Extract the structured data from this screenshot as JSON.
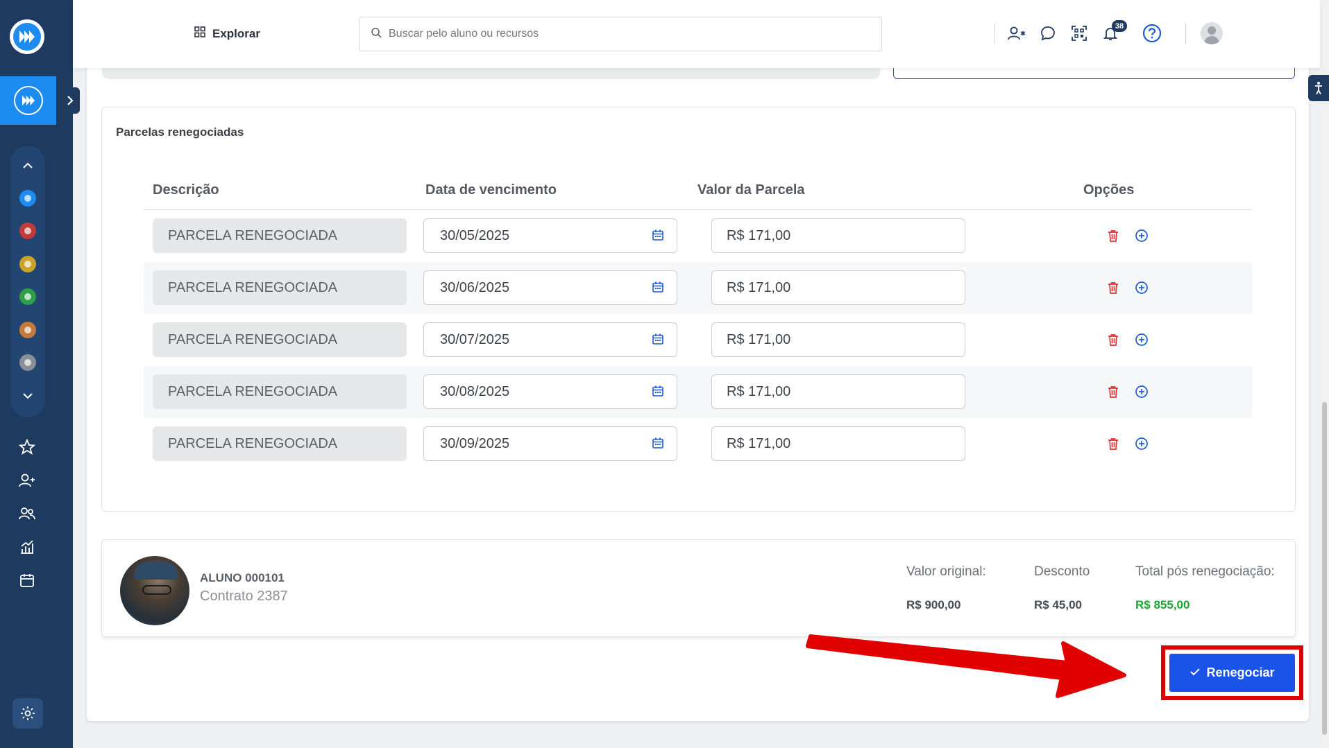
{
  "header": {
    "explore_label": "Explorar",
    "search_placeholder": "Buscar pelo aluno ou recursos",
    "notifications_count": "38"
  },
  "parcelas": {
    "title": "Parcelas renegociadas",
    "columns": {
      "descricao": "Descrição",
      "vencimento": "Data de vencimento",
      "valor": "Valor da Parcela",
      "opcoes": "Opções"
    },
    "rows": [
      {
        "descricao": "PARCELA RENEGOCIADA",
        "vencimento": "30/05/2025",
        "valor": "R$ 171,00"
      },
      {
        "descricao": "PARCELA RENEGOCIADA",
        "vencimento": "30/06/2025",
        "valor": "R$ 171,00"
      },
      {
        "descricao": "PARCELA RENEGOCIADA",
        "vencimento": "30/07/2025",
        "valor": "R$ 171,00"
      },
      {
        "descricao": "PARCELA RENEGOCIADA",
        "vencimento": "30/08/2025",
        "valor": "R$ 171,00"
      },
      {
        "descricao": "PARCELA RENEGOCIADA",
        "vencimento": "30/09/2025",
        "valor": "R$ 171,00"
      }
    ]
  },
  "summary": {
    "student_name": "ALUNO 000101",
    "contract": "Contrato 2387",
    "valor_original_label": "Valor original:",
    "valor_original": "R$ 900,00",
    "desconto_label": "Desconto",
    "desconto": "R$ 45,00",
    "total_label": "Total pós renegociação:",
    "total": "R$ 855,00"
  },
  "actions": {
    "renegociar_label": "Renegociar"
  },
  "colors": {
    "sidebar": "#1e3a5f",
    "accent": "#1c8bf2",
    "primary_button": "#1a53e8",
    "delete_icon": "#e03131",
    "add_icon": "#1c5bd9",
    "total_green": "#1aa52c",
    "annotation_red": "#e00000"
  },
  "icons": {
    "logo": "brand-logo-icon",
    "explore": "grid-icon",
    "search": "search-icon",
    "add_person": "person-add-icon",
    "chat": "chat-icon",
    "qr": "qr-code-icon",
    "bell": "bell-icon",
    "help": "help-icon",
    "calendar": "calendar-icon",
    "delete": "trash-icon",
    "add": "plus-circle-icon"
  }
}
